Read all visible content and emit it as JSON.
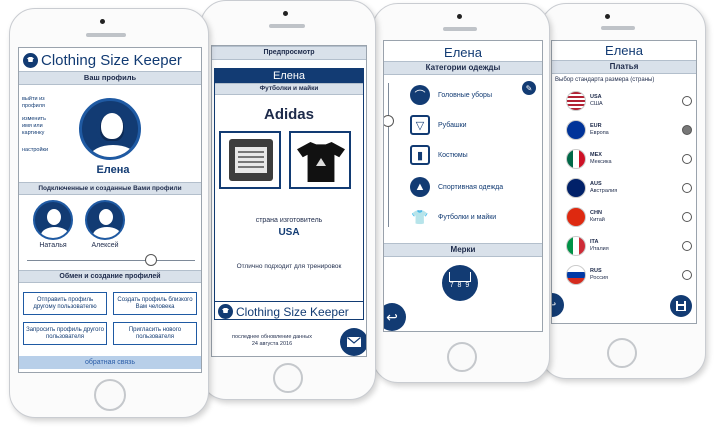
{
  "phone1": {
    "app_title": "Clothing Size Keeper",
    "profile_bar": "Ваш профиль",
    "side_labels": [
      "выйти из",
      "профиля",
      "изменить",
      "имя или",
      "картинку",
      "настройки"
    ],
    "user_name": "Елена",
    "connected_bar": "Подключенные и созданные Вами профили",
    "profiles": [
      "Наталья",
      "Алексей"
    ],
    "exchange_bar": "Обмен и создание профилей",
    "buttons": [
      "Отправить профиль другому пользователю",
      "Создать профиль близкого Вам человека",
      "Запросить профиль другого пользователя",
      "Пригласить нового пользователя"
    ],
    "feedback": "обратная связь"
  },
  "phone2": {
    "preview_bar": "Предпросмотр",
    "user_name": "Елена",
    "category": "Футболки и майки",
    "brand": "Adidas",
    "country_label": "страна изготовитель",
    "country": "USA",
    "note": "Отлично подходит для тренировок",
    "app_title": "Clothing Size Keeper",
    "last_update": "последнее обновление данных",
    "last_update_date": "24 августа 2016"
  },
  "phone3": {
    "user_name": "Елена",
    "categories_bar": "Категории одежды",
    "categories": [
      "Головные уборы",
      "Рубашки",
      "Костюмы",
      "Спортивная одежда",
      "Футболки и майки"
    ],
    "measures_bar": "Мерки",
    "ruler_numbers": "7 8 9"
  },
  "phone4": {
    "user_name": "Елена",
    "section_bar": "Платья",
    "standard_label": "Выбор стандарта размера (страны)",
    "countries": [
      {
        "code": "USA",
        "name": "США",
        "selected": false
      },
      {
        "code": "EUR",
        "name": "Европа",
        "selected": true
      },
      {
        "code": "MEX",
        "name": "Мексика",
        "selected": false
      },
      {
        "code": "AUS",
        "name": "Австралия",
        "selected": false
      },
      {
        "code": "CHN",
        "name": "Китай",
        "selected": false
      },
      {
        "code": "ITA",
        "name": "Италия",
        "selected": false
      },
      {
        "code": "RUS",
        "name": "Россия",
        "selected": false
      }
    ]
  },
  "colors": {
    "navy": "#123b73",
    "bar_bg": "#d9e1ea",
    "feedback_bg": "#b8cfe9"
  }
}
